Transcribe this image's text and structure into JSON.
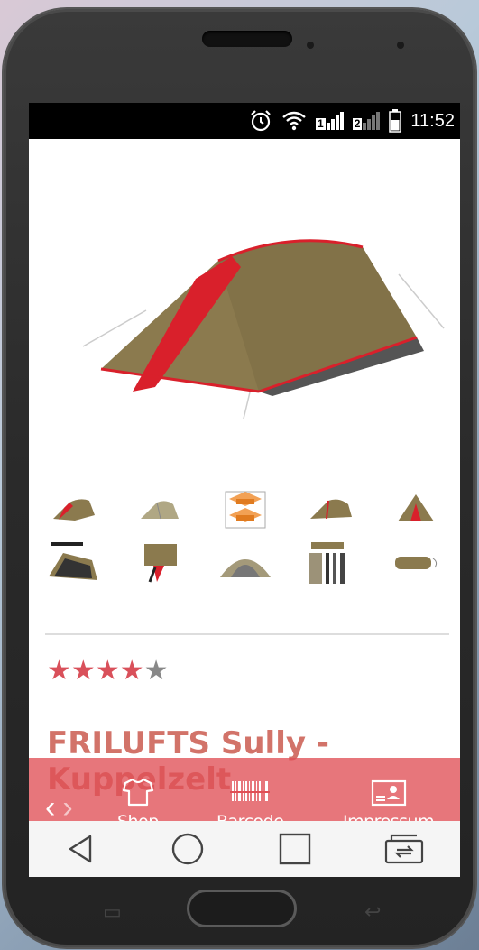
{
  "status_bar": {
    "time": "11:52",
    "icons": [
      "alarm-icon",
      "wifi-icon",
      "signal-sim1-icon",
      "signal-sim2-icon",
      "battery-icon"
    ],
    "sim1_label": "1",
    "sim2_label": "2"
  },
  "product": {
    "rating": 4,
    "rating_max": 5,
    "title": "FRILUFTS Sully - Kuppelzelt"
  },
  "thumbnails": {
    "row1": [
      "tent-front-thumb",
      "tent-side-thumb",
      "floorplan-thumb",
      "tent-back-thumb",
      "tent-open-thumb"
    ],
    "row2": [
      "tent-inner-thumb",
      "tent-detail-thumb",
      "tent-vestibule-thumb",
      "tent-parts-thumb",
      "tent-bag-thumb"
    ]
  },
  "bottom_nav": {
    "shop_label": "Shop",
    "barcode_label": "Barcode",
    "impressum_label": "Impressum"
  },
  "colors": {
    "accent": "#e05056",
    "tent_body": "#8b7a4e",
    "tent_trim": "#d9202b"
  }
}
